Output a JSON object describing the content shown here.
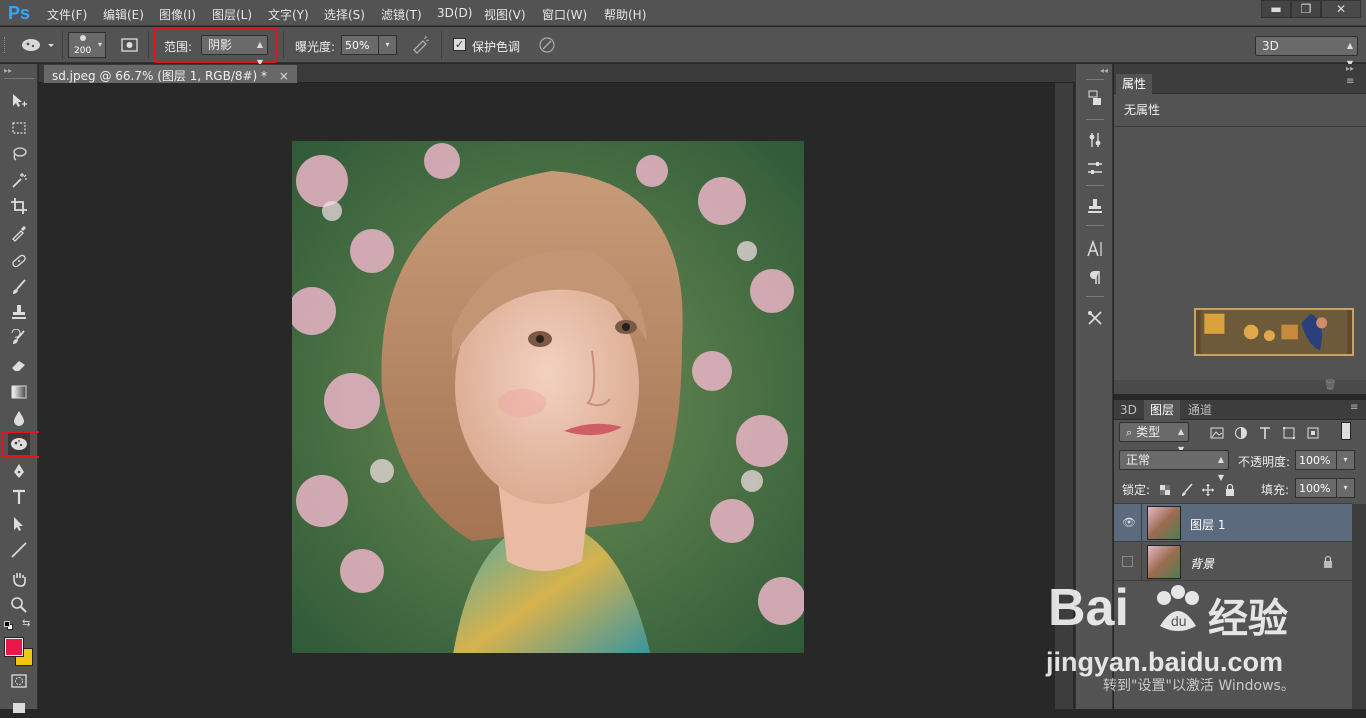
{
  "app": {
    "logo": "Ps"
  },
  "menu": [
    "文件(F)",
    "编辑(E)",
    "图像(I)",
    "图层(L)",
    "文字(Y)",
    "选择(S)",
    "滤镜(T)",
    "3D(D)",
    "视图(V)",
    "窗口(W)",
    "帮助(H)"
  ],
  "window_controls": {
    "minimize": "▬",
    "restore": "❐",
    "close": "✕"
  },
  "options": {
    "brush_size": "200",
    "range_label": "范围:",
    "range_value": "阴影",
    "exposure_label": "曝光度:",
    "exposure_value": "50%",
    "protect_tones_label": "保护色调",
    "protect_tones_checked": true,
    "workspace": "3D"
  },
  "document": {
    "tab_title": "sd.jpeg @ 66.7% (图层 1, RGB/8#) *",
    "close": "×"
  },
  "properties": {
    "tab_label": "属性",
    "content": "无属性"
  },
  "layers_panel": {
    "tabs": [
      "3D",
      "图层",
      "通道"
    ],
    "active_tab": 1,
    "filter_label": "类型",
    "blend_mode": "正常",
    "opacity_label": "不透明度:",
    "opacity_value": "100%",
    "lock_label": "锁定:",
    "fill_label": "填充:",
    "fill_value": "100%",
    "layers": [
      {
        "name": "图层 1",
        "visible": true,
        "selected": true,
        "locked": false
      },
      {
        "name": "背景",
        "visible": false,
        "selected": false,
        "locked": true
      }
    ]
  },
  "colors": {
    "foreground": "#e8194a",
    "background": "#f2c80f",
    "highlight_box": "#e4141d",
    "accent": "#31a8ff"
  },
  "watermark": {
    "brand_left": "Bai",
    "brand_right": "经验",
    "domain": "jingyan.baidu.com",
    "activation": "转到\"设置\"以激活 Windows。",
    "activation_prefix": "激活 Windows"
  }
}
